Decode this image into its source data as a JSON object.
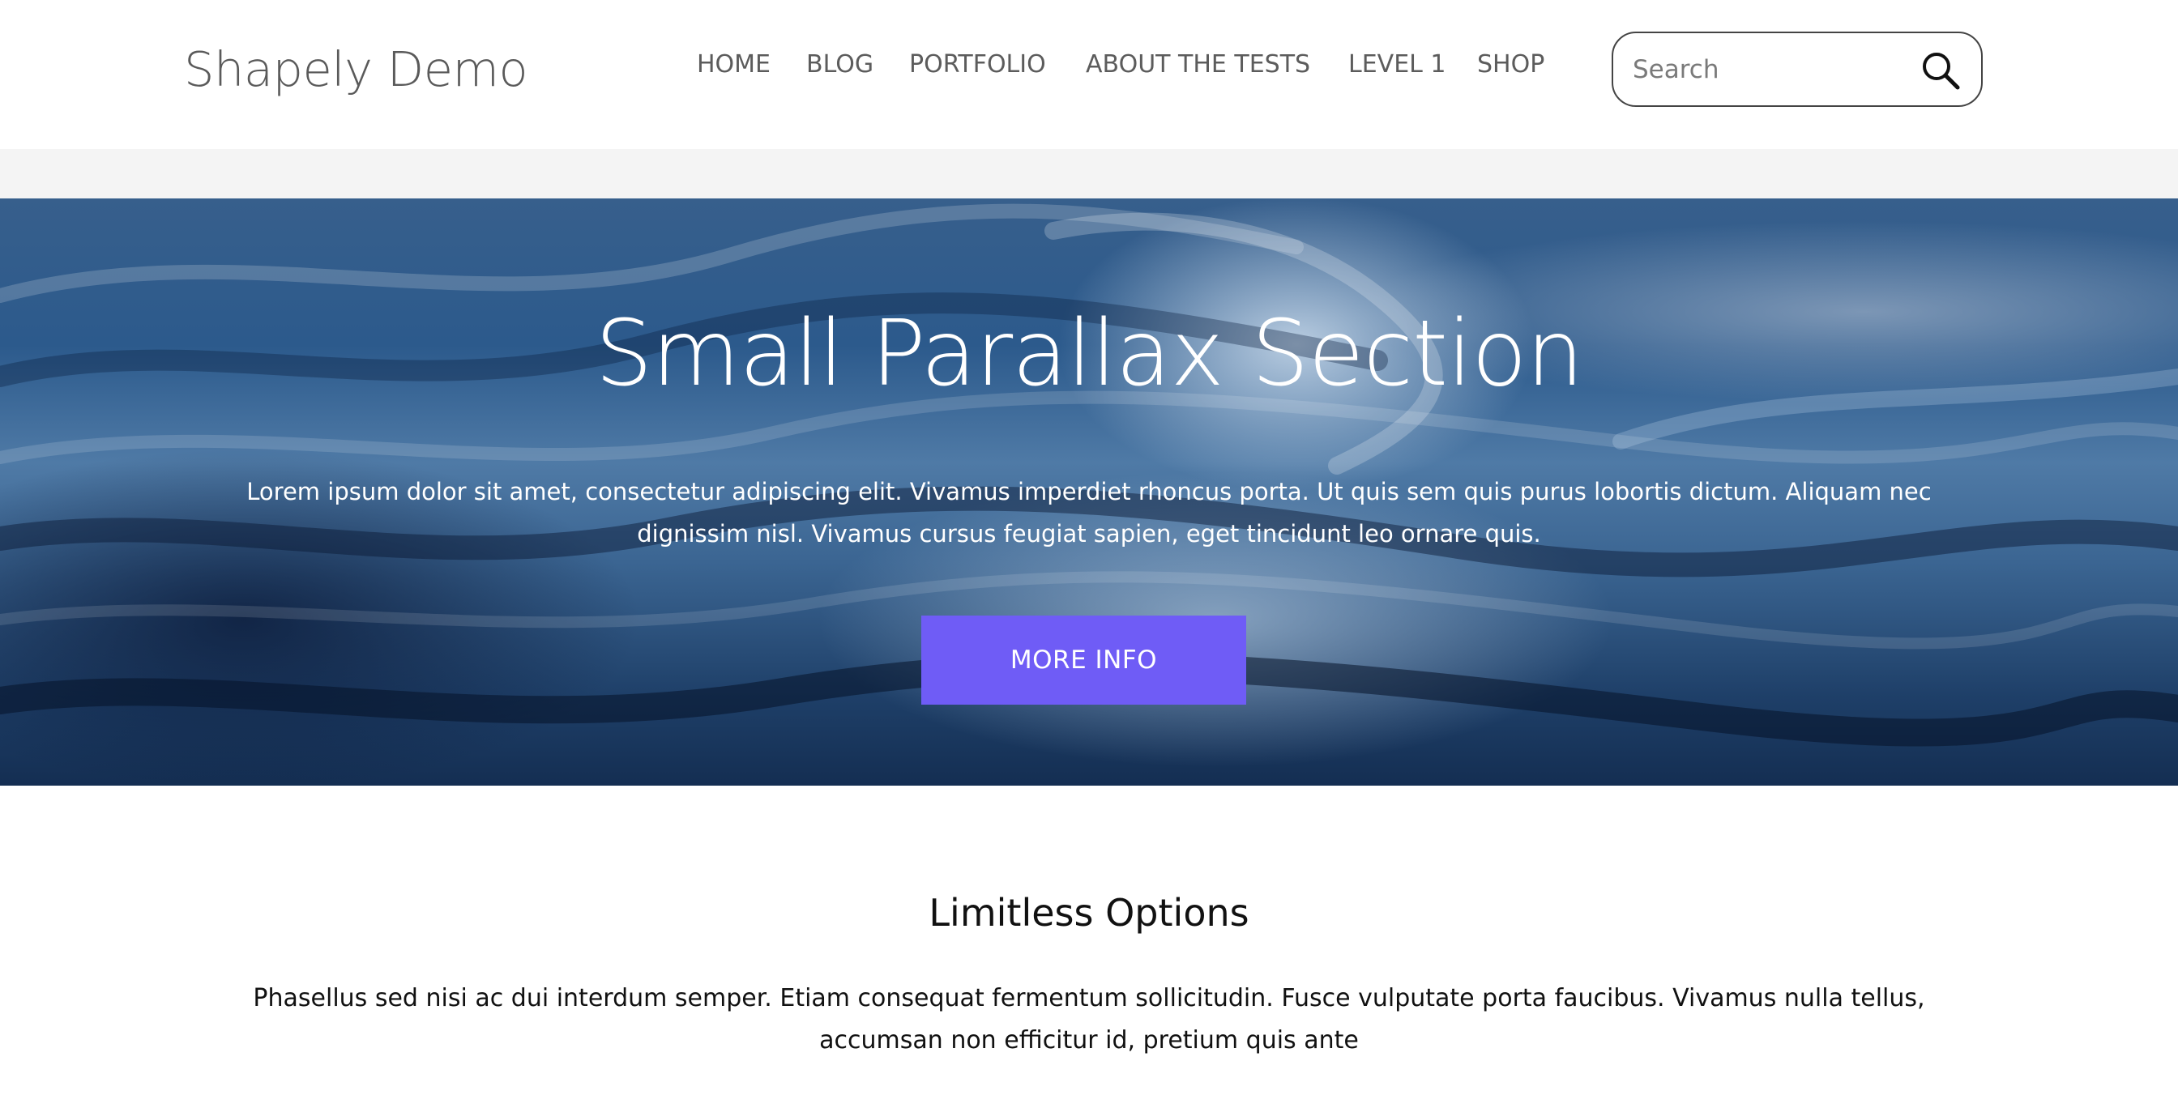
{
  "header": {
    "site_title": "Shapely Demo",
    "nav": [
      "HOME",
      "BLOG",
      "PORTFOLIO",
      "ABOUT THE TESTS",
      "LEVEL 1",
      "SHOP"
    ],
    "search_placeholder": "Search",
    "search_icon": "search-icon"
  },
  "hero": {
    "title": "Small Parallax Section",
    "text": "Lorem ipsum dolor sit amet, consectetur adipiscing elit. Vivamus imperdiet rhoncus porta. Ut quis sem quis purus lobortis dictum. Aliquam nec dignissim nisl. Vivamus cursus feugiat sapien, eget tincidunt leo ornare quis.",
    "button_label": "MORE INFO",
    "button_color": "#6f5cf6"
  },
  "section": {
    "title": "Limitless Options",
    "text": "Phasellus sed nisi ac dui interdum semper. Etiam consequat fermentum sollicitudin. Fusce vulputate porta faucibus. Vivamus nulla tellus, accumsan non efficitur id, pretium quis ante"
  }
}
